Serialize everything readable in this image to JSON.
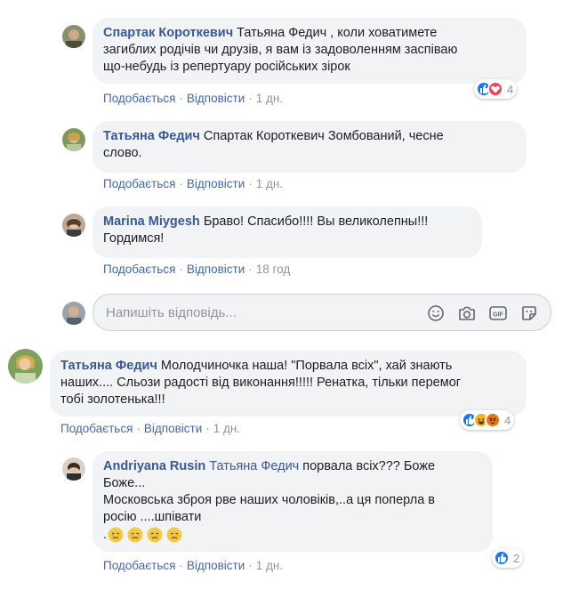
{
  "comments": [
    {
      "author": "Спартак Короткевич",
      "text_l1": "Татьяна Федич , коли ховатимете",
      "text_l2": "загиблих родічів чи друзів, я вам із задоволенням заспіваю",
      "text_l3": "що-небудь із репертуару російських зірок",
      "like": "Подобається",
      "reply": "Відповісти",
      "time": "1 дн.",
      "reactions_count": "4"
    },
    {
      "author": "Татьяна Федич",
      "text_l1": "Спартак Короткевич Зомбований, чесне",
      "text_l2": "слово.",
      "like": "Подобається",
      "reply": "Відповісти",
      "time": "1 дн."
    },
    {
      "author": "Marina Miygesh",
      "text_l1": "Браво! Спасибо!!!! Вы великолепны!!!",
      "text_l2": "Гордимся!",
      "like": "Подобається",
      "reply": "Відповісти",
      "time": "18 год"
    },
    {
      "author": "Татьяна Федич",
      "text_l1": "Молодчиночка наша! \"Порвала всіх\", хай знають",
      "text_l2": "наших.... Сльози радості від виконання!!!!! Ренатка, тільки перемог",
      "text_l3": "тобі золотенька!!!",
      "like": "Подобається",
      "reply": "Відповісти",
      "time": "1 дн.",
      "reactions_count": "4"
    },
    {
      "author": "Andriyana Rusin",
      "mention": "Татьяна Федич",
      "text_l1": "порвала всіх??? Боже",
      "text_l2": "Боже...",
      "text_l3": "Московська зброя рве наших чоловіків,..а ця поперла в",
      "text_l4": "росію ....шпівати",
      "text_l5": ".",
      "like": "Подобається",
      "reply": "Відповісти",
      "time": "1 дн.",
      "reactions_count": "2"
    }
  ],
  "reply_box": {
    "placeholder": "Напишіть відповідь..."
  },
  "colors": {
    "link": "#385898",
    "bubble": "#f2f3f5",
    "like_blue": "#1877f2",
    "love_red": "#f33e58",
    "haha_yellow": "#f7b125",
    "angry_orange": "#e9710f"
  },
  "icons": [
    "emoji-icon",
    "camera-icon",
    "gif-icon",
    "sticker-icon",
    "like-reaction-icon",
    "love-reaction-icon",
    "haha-reaction-icon",
    "angry-reaction-icon",
    "sad-emoji-icon"
  ]
}
